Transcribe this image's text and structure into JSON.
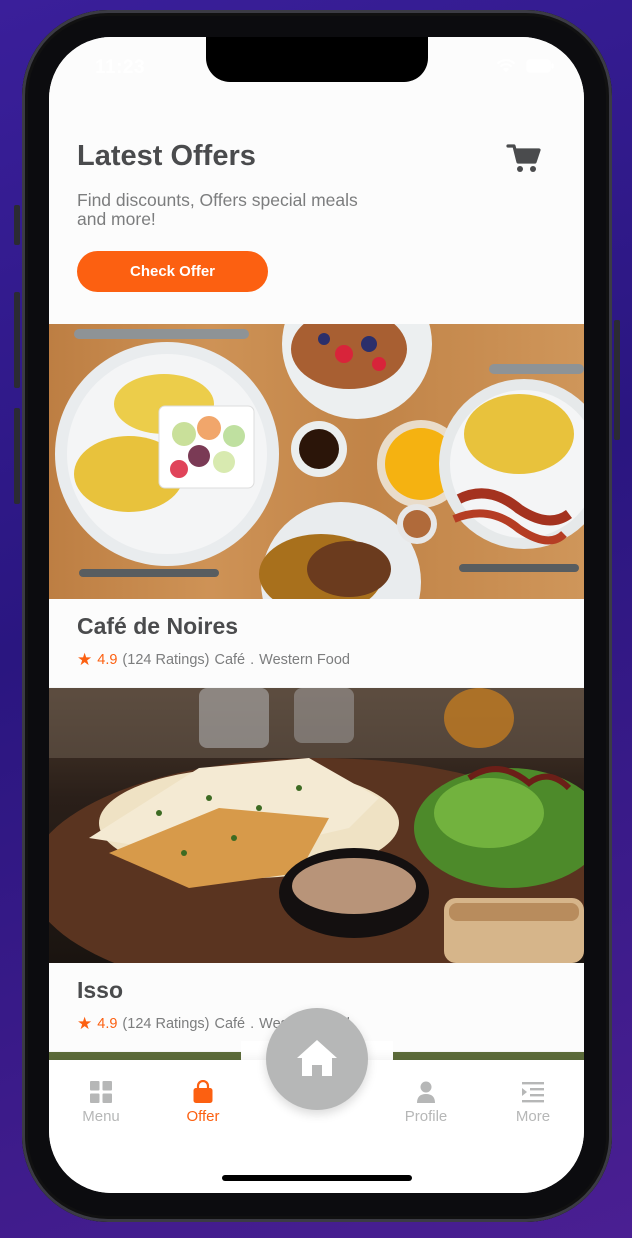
{
  "status": {
    "time": "11:23"
  },
  "header": {
    "title": "Latest Offers",
    "subtitle": "Find discounts, Offers special meals and more!",
    "check_offer_label": "Check Offer"
  },
  "offers": [
    {
      "name": "Café de Noires",
      "rating": "4.9",
      "ratings_count": "(124 Ratings)",
      "category": "Café",
      "separator": ".",
      "cuisine": "Western Food"
    },
    {
      "name": "Isso",
      "rating": "4.9",
      "ratings_count": "(124 Ratings)",
      "category": "Café",
      "separator": ".",
      "cuisine": "Western Food"
    }
  ],
  "tabbar": {
    "items": [
      {
        "label": "Menu"
      },
      {
        "label": "Offer"
      },
      {
        "label": "Profile"
      },
      {
        "label": "More"
      }
    ],
    "active": "Offer"
  },
  "colors": {
    "accent": "#fc6011",
    "inactive": "#b6b7b7",
    "text_primary": "#4a4b4d",
    "text_secondary": "#7c7d7e"
  },
  "icons": [
    "cart-icon",
    "star-icon",
    "menu-grid-icon",
    "shopping-bag-icon",
    "home-icon",
    "profile-icon",
    "more-icon",
    "wifi-icon",
    "battery-icon"
  ]
}
